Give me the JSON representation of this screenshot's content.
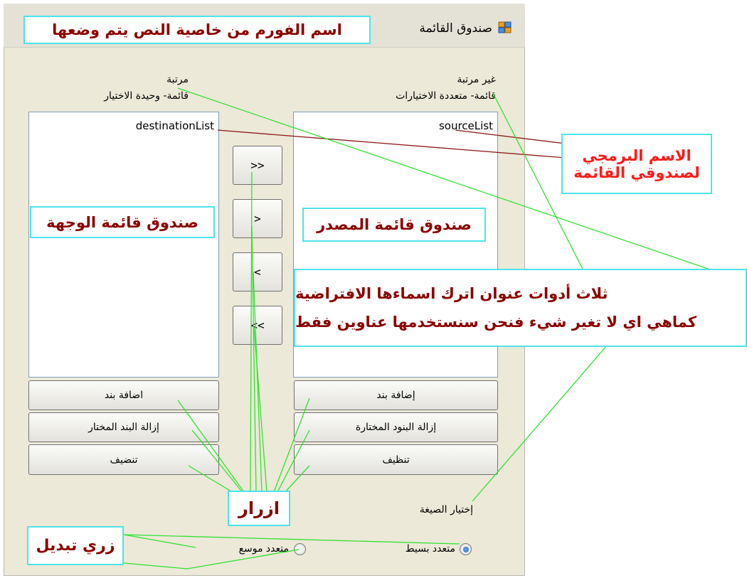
{
  "window": {
    "title": "صندوق القائمة",
    "icon": "form-icon"
  },
  "labels": {
    "right_top_1": "غير مرتبة",
    "right_top_2": "قائمة- متعددة الاختيارات",
    "left_top_1": "مرتبة",
    "left_top_2": "قائمة- وحيدة الاختيار",
    "format_label": "إختيار الصيغة"
  },
  "lists": {
    "source_name": "sourceList",
    "destination_name": "destinationList"
  },
  "arrows": [
    ">>",
    ">",
    "<",
    "<<"
  ],
  "right_buttons": {
    "add": "إضافة بند",
    "remove": "إزالة البنود المختارة",
    "clear": "تنظيف"
  },
  "left_buttons": {
    "add": "اضافة بند",
    "remove": "إزالة البند المختار",
    "clear": "تنضيف"
  },
  "radios": {
    "simple_label": "متعدد بسيط",
    "simple_checked": true,
    "extended_label": "متعدد موسع",
    "extended_checked": false
  },
  "annotations": {
    "form_name": "اسم الفورم من خاصية النص يتم وضعها",
    "programmatic_1": "الاسم البرمجي",
    "programmatic_2": "لصندوقي القائمة",
    "source_box": "صندوق قائمة المصدر",
    "dest_box": "صندوق قائمة الوجهة",
    "labels_1": "ثلاث أدوات عنوان اترك اسماءها  الافتراضية",
    "labels_2": "كماهي اي لا تغير شيء فنحن سنستخدمها عناوين فقط",
    "buttons": "ازرار",
    "radios": "زري تبديل"
  },
  "colors": {
    "annotation_border": "#4fe3ea",
    "annotation_text": "#8b0000",
    "annotation_red": "#ff1a1a",
    "connector_green": "#33e033",
    "connector_darkred": "#8b1a1a",
    "form_bg": "#ece9d8",
    "radio_selected": "#1a5fc8"
  }
}
